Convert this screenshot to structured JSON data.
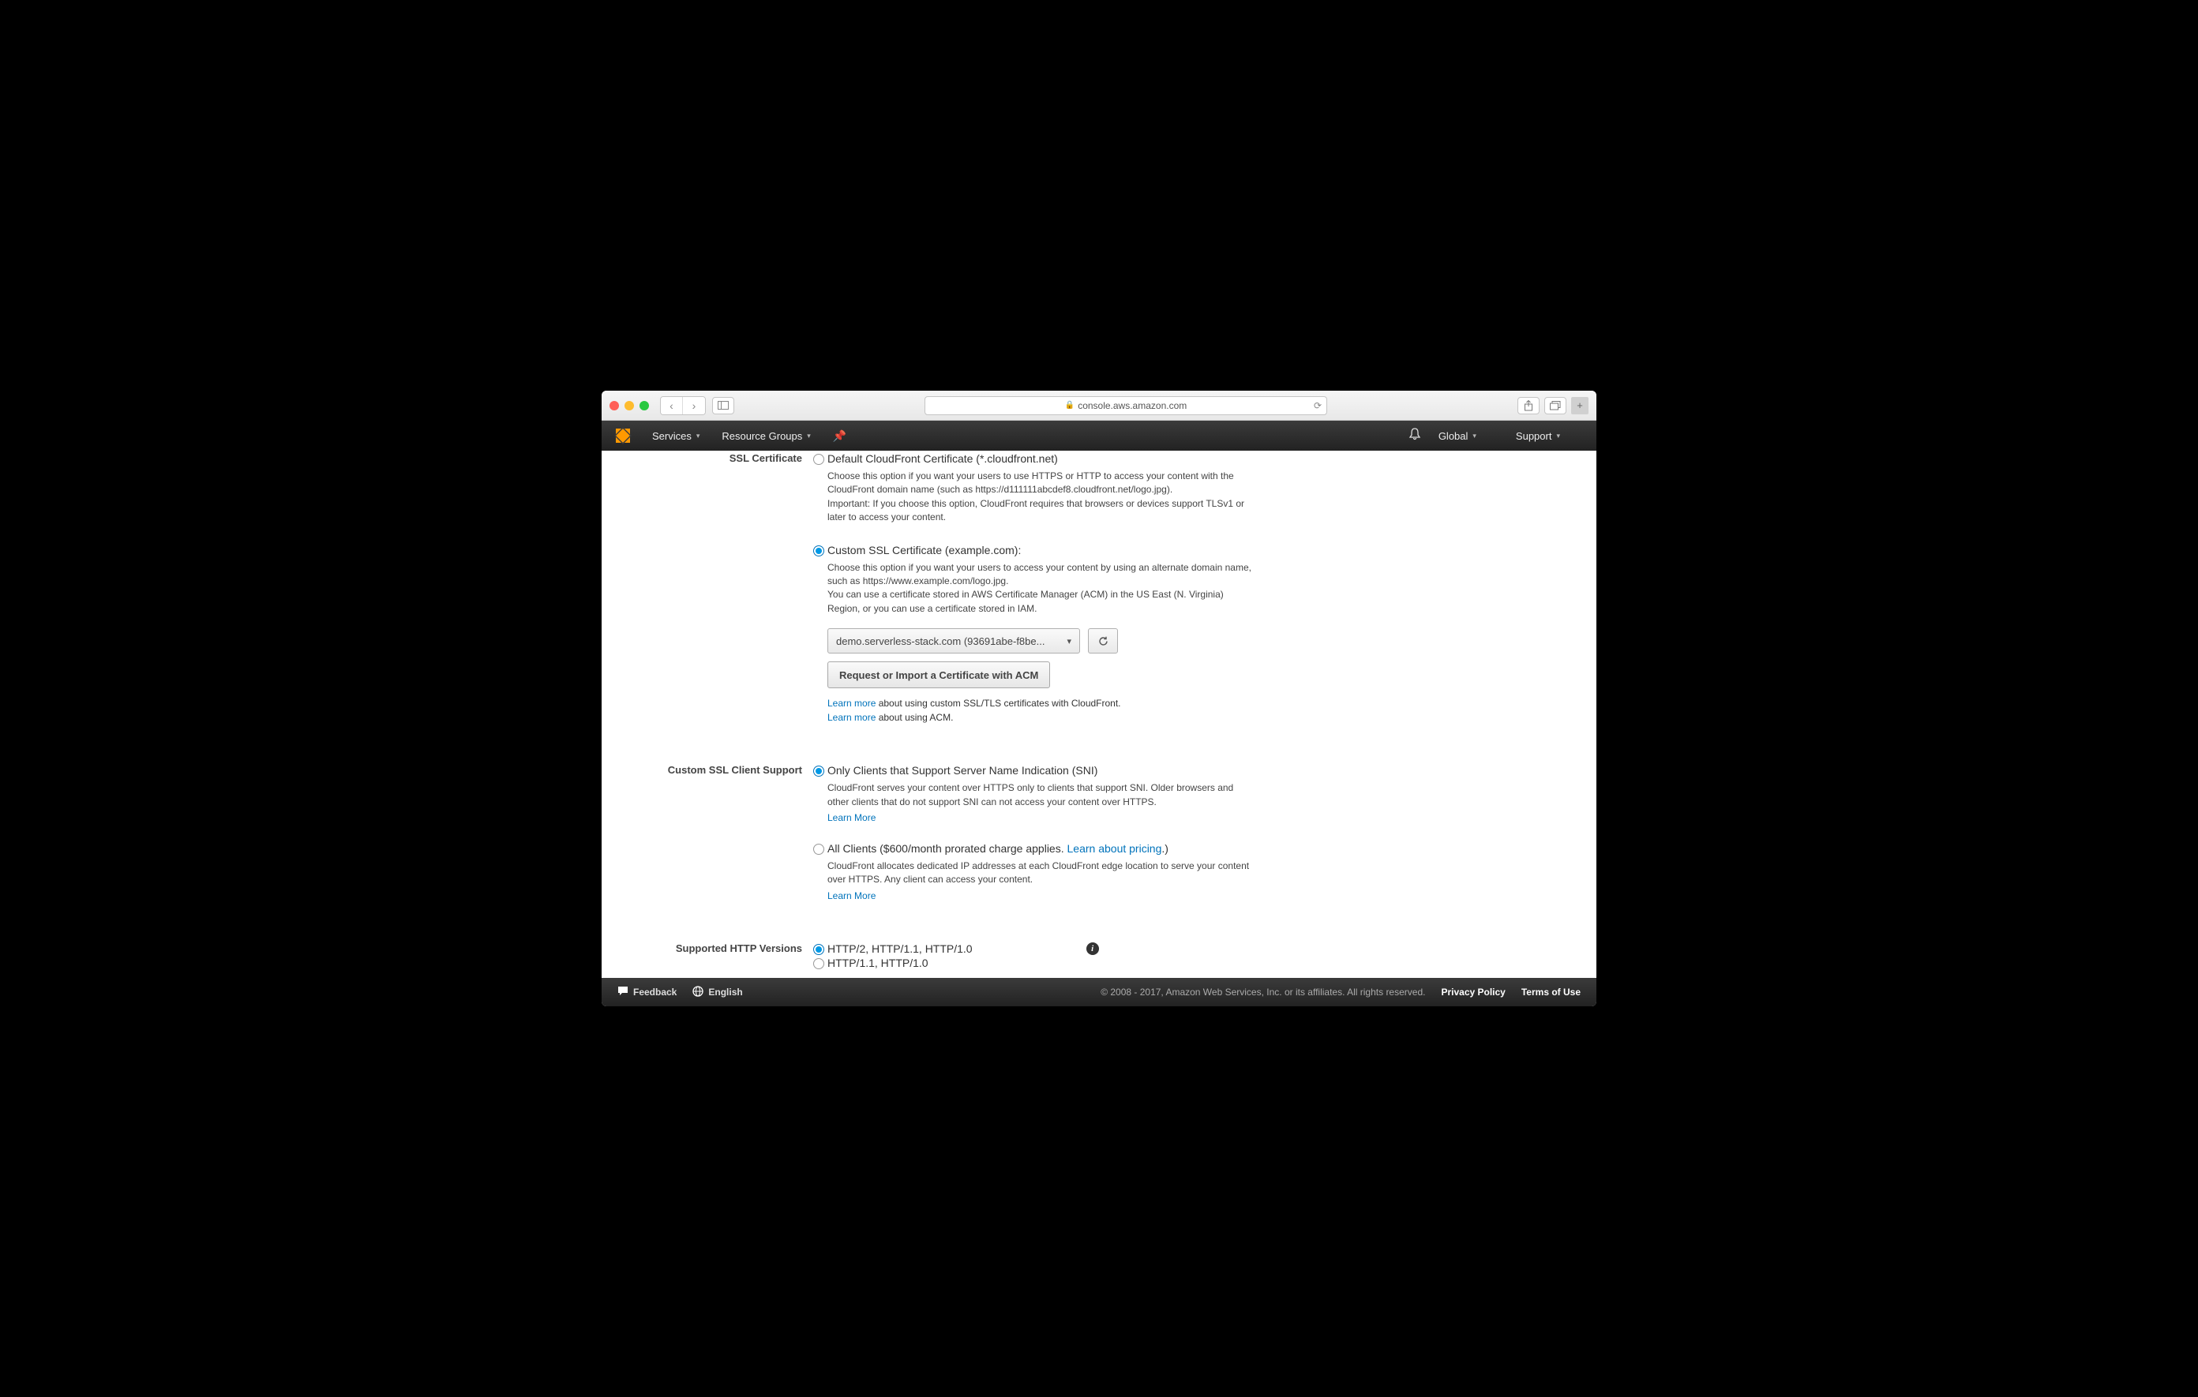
{
  "browser": {
    "address": "console.aws.amazon.com"
  },
  "aws_header": {
    "services": "Services",
    "resource_groups": "Resource Groups",
    "region": "Global",
    "support": "Support"
  },
  "ssl_cert": {
    "label": "SSL Certificate",
    "default_radio": "Default CloudFront Certificate (*.cloudfront.net)",
    "default_desc": "Choose this option if you want your users to use HTTPS or HTTP to access your content with the CloudFront domain name (such as https://d111111abcdef8.cloudfront.net/logo.jpg).\nImportant: If you choose this option, CloudFront requires that browsers or devices support TLSv1 or later to access your content.",
    "custom_radio": "Custom SSL Certificate (example.com):",
    "custom_desc": "Choose this option if you want your users to access your content by using an alternate domain name, such as https://www.example.com/logo.jpg.\nYou can use a certificate stored in AWS Certificate Manager (ACM) in the US East (N. Virginia) Region, or you can use a certificate stored in IAM.",
    "cert_value": "demo.serverless-stack.com (93691abe-f8be...",
    "acm_button": "Request or Import a Certificate with ACM",
    "learn_more": "Learn more",
    "learn1_suffix": " about using custom SSL/TLS certificates with CloudFront.",
    "learn2_suffix": " about using ACM."
  },
  "client_support": {
    "label": "Custom SSL Client Support",
    "sni_radio": "Only Clients that Support Server Name Indication (SNI)",
    "sni_desc": "CloudFront serves your content over HTTPS only to clients that support SNI. Older browsers and other clients that do not support SNI can not access your content over HTTPS.",
    "learn_more": "Learn More",
    "all_radio_prefix": "All Clients ($600/month prorated charge applies. ",
    "all_radio_link": "Learn about pricing",
    "all_radio_suffix": ".)",
    "all_desc": "CloudFront allocates dedicated IP addresses at each CloudFront edge location to serve your content over HTTPS. Any client can access your content."
  },
  "http_versions": {
    "label": "Supported HTTP Versions",
    "opt1": "HTTP/2, HTTP/1.1, HTTP/1.0",
    "opt2": "HTTP/1.1, HTTP/1.0"
  },
  "footer": {
    "feedback": "Feedback",
    "language": "English",
    "copyright": "© 2008 - 2017, Amazon Web Services, Inc. or its affiliates. All rights reserved.",
    "privacy": "Privacy Policy",
    "terms": "Terms of Use"
  }
}
